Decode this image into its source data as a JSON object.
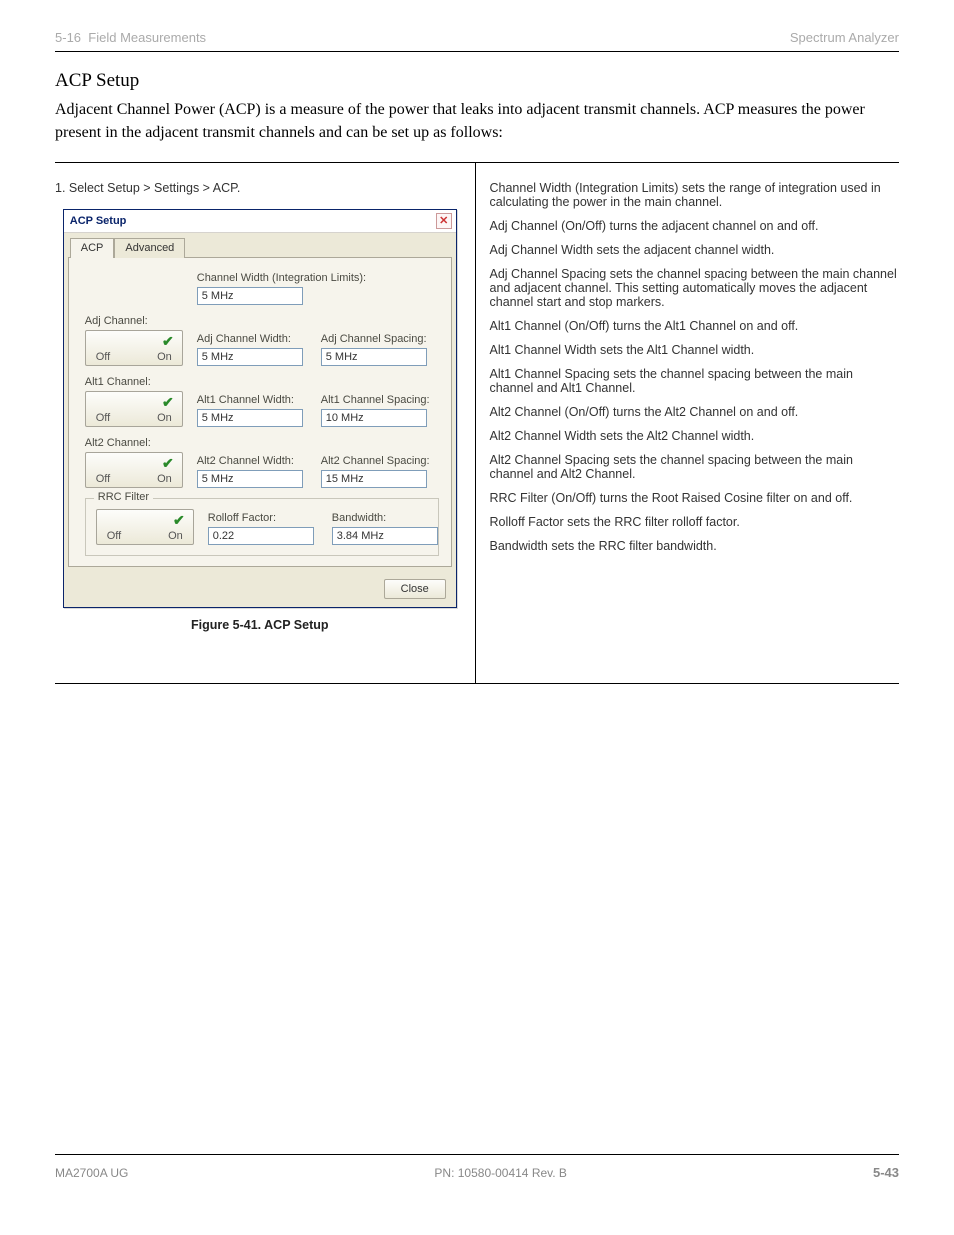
{
  "header": {
    "chapter_num": "5",
    "chapter_title": "Spectrum Analyzer"
  },
  "section": {
    "title": "ACP Setup",
    "body": "Adjacent Channel Power (ACP) is a measure of the power that leaks into adjacent transmit channels. ACP measures the power present in the adjacent transmit channels and can be set up as follows:"
  },
  "left": {
    "step": "1. Select Setup > Settings > ACP.",
    "caption": "Figure 5-41. ACP Setup"
  },
  "right": {
    "items": [
      "Channel Width (Integration Limits) sets the range of integration used in calculating the power in the main channel.",
      "Adj Channel (On/Off) turns the adjacent channel on and off.",
      "Adj Channel Width sets the adjacent channel width.",
      "Adj Channel Spacing sets the channel spacing between the main channel and adjacent channel. This setting automatically moves the adjacent channel start and stop markers.",
      "Alt1 Channel (On/Off) turns the Alt1 Channel on and off.",
      "Alt1 Channel Width sets the Alt1 Channel width.",
      "Alt1 Channel Spacing sets the channel spacing between the main channel and Alt1 Channel.",
      "Alt2 Channel (On/Off) turns the Alt2 Channel on and off.",
      "Alt2 Channel Width sets the Alt2 Channel width.",
      "Alt2 Channel Spacing sets the channel spacing between the main channel and Alt2 Channel.",
      "RRC Filter (On/Off) turns the Root Raised Cosine filter on and off.",
      "Rolloff Factor sets the RRC filter rolloff factor.",
      "Bandwidth sets the RRC filter bandwidth."
    ]
  },
  "dialog": {
    "title": "ACP Setup",
    "tabs": {
      "acp": "ACP",
      "advanced": "Advanced"
    },
    "labels": {
      "channel_width": "Channel Width (Integration Limits):",
      "adj_channel": "Adj Channel:",
      "adj_channel_width": "Adj Channel Width:",
      "adj_channel_spacing": "Adj Channel Spacing:",
      "alt1_channel": "Alt1 Channel:",
      "alt1_channel_width": "Alt1 Channel Width:",
      "alt1_channel_spacing": "Alt1 Channel Spacing:",
      "alt2_channel": "Alt2 Channel:",
      "alt2_channel_width": "Alt2 Channel Width:",
      "alt2_channel_spacing": "Alt2 Channel Spacing:",
      "rrc_filter": "RRC Filter",
      "rolloff": "Rolloff Factor:",
      "bandwidth": "Bandwidth:",
      "off": "Off",
      "on": "On",
      "close": "Close"
    },
    "values": {
      "channel_width": "5 MHz",
      "adj_channel_width": "5 MHz",
      "adj_channel_spacing": "5 MHz",
      "alt1_channel_width": "5 MHz",
      "alt1_channel_spacing": "10 MHz",
      "alt2_channel_width": "5 MHz",
      "alt2_channel_spacing": "15 MHz",
      "rolloff": "0.22",
      "bandwidth": "3.84 MHz"
    }
  },
  "footer": {
    "doc": "MA2700A UG",
    "pn": "PN: 10580-00414 Rev. B",
    "page": "5-43"
  }
}
